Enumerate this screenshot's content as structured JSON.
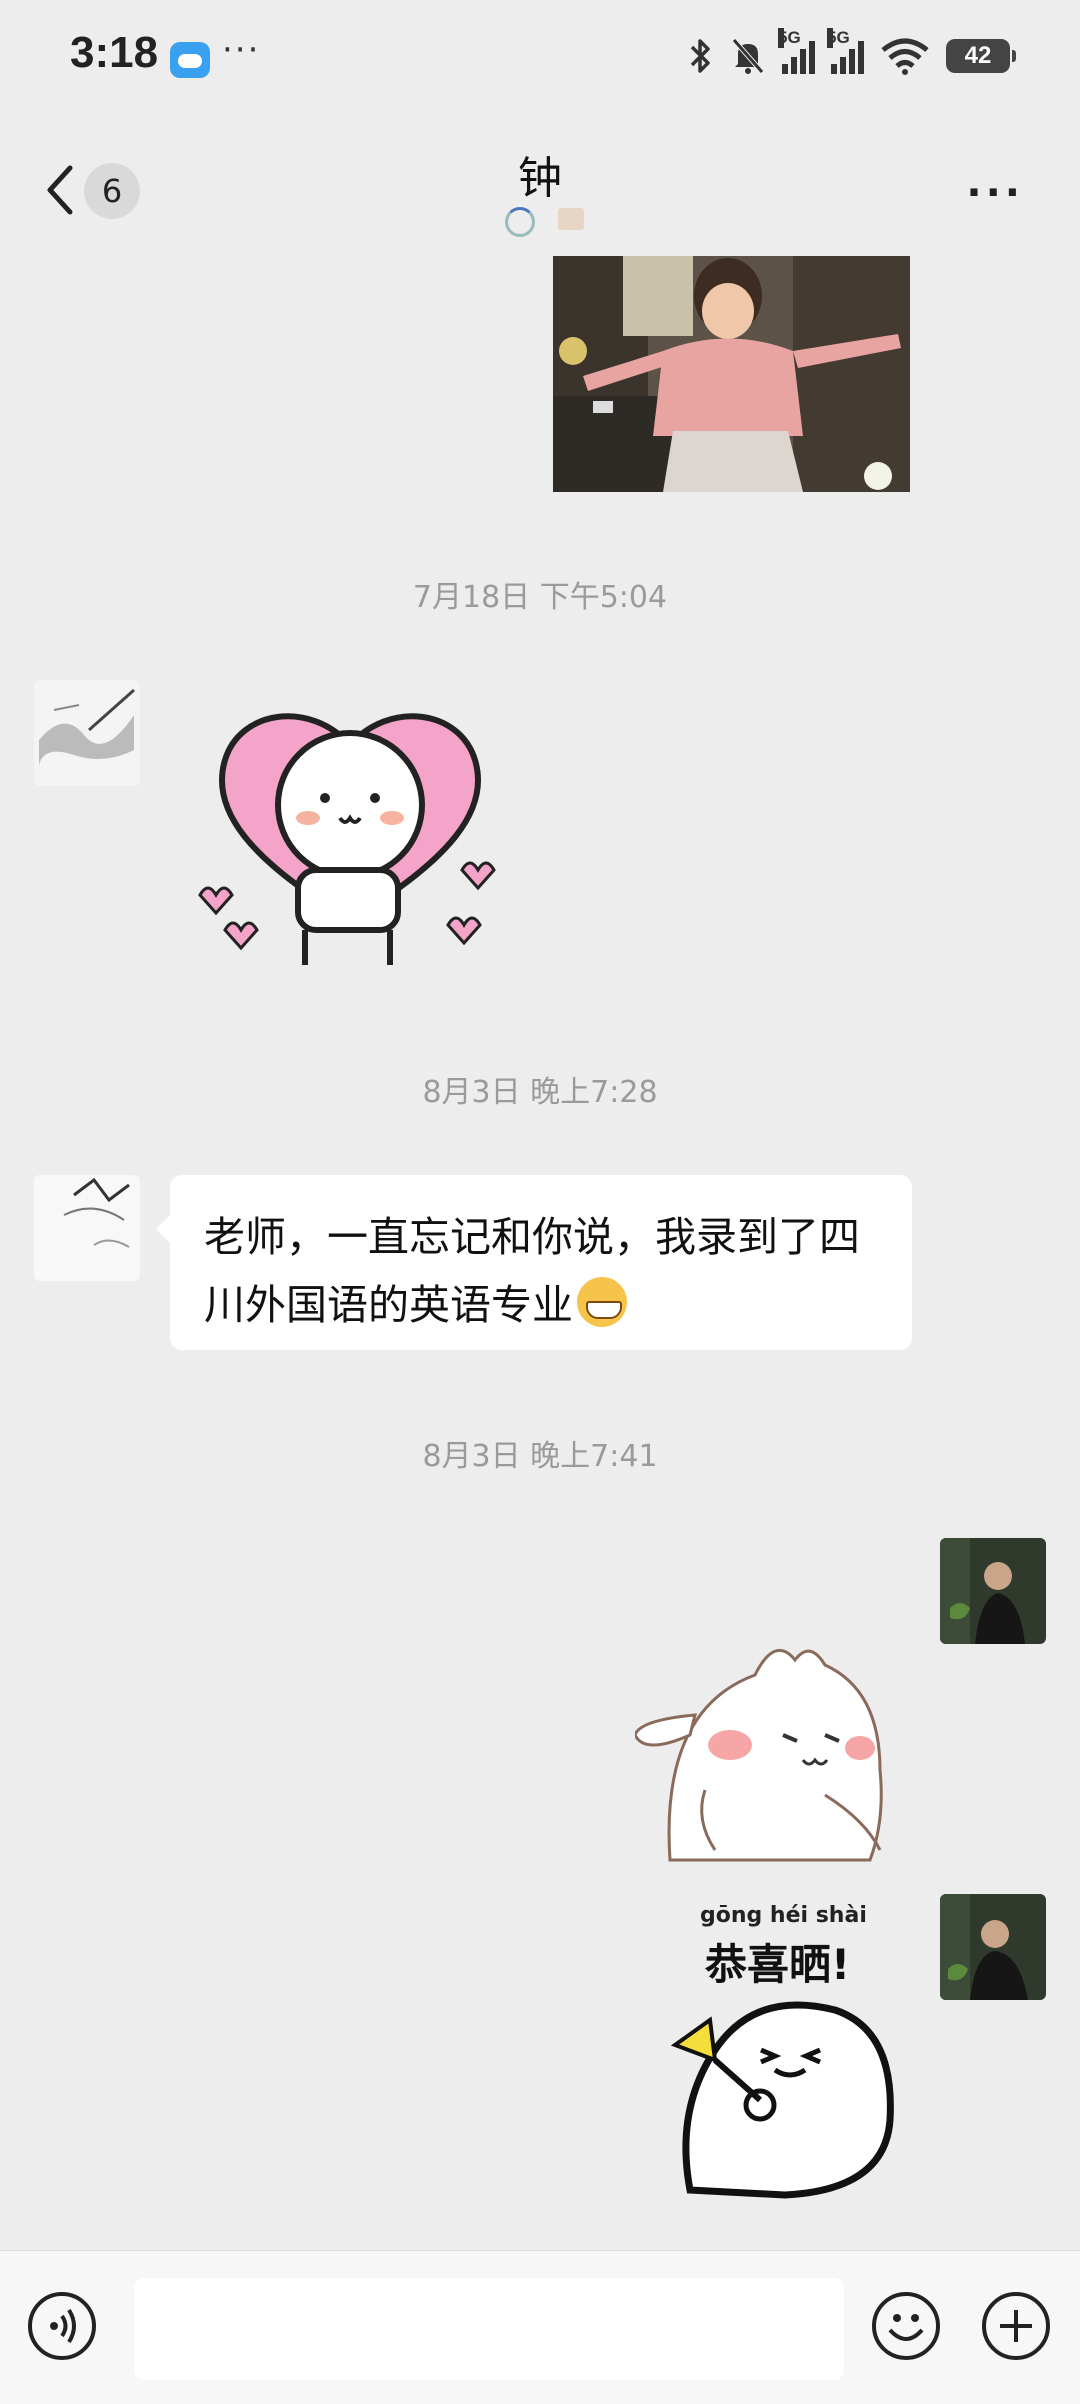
{
  "status_bar": {
    "time": "3:18",
    "more": "···",
    "signal1_label": "5G",
    "signal2_label": "5G",
    "battery": "42"
  },
  "header": {
    "unread_count": "6",
    "title": "钟",
    "more": "···"
  },
  "messages": {
    "ts1": "7月18日 下午5:04",
    "ts2": "8月3日 晚上7:28",
    "text1": "老师，一直忘记和你说，我录到了四川外国语的英语专业",
    "ts3": "8月3日 晚上7:41"
  },
  "sticker": {
    "pinyin": "gōng héi shài",
    "caption": "恭喜晒!"
  },
  "input": {
    "placeholder": ""
  }
}
